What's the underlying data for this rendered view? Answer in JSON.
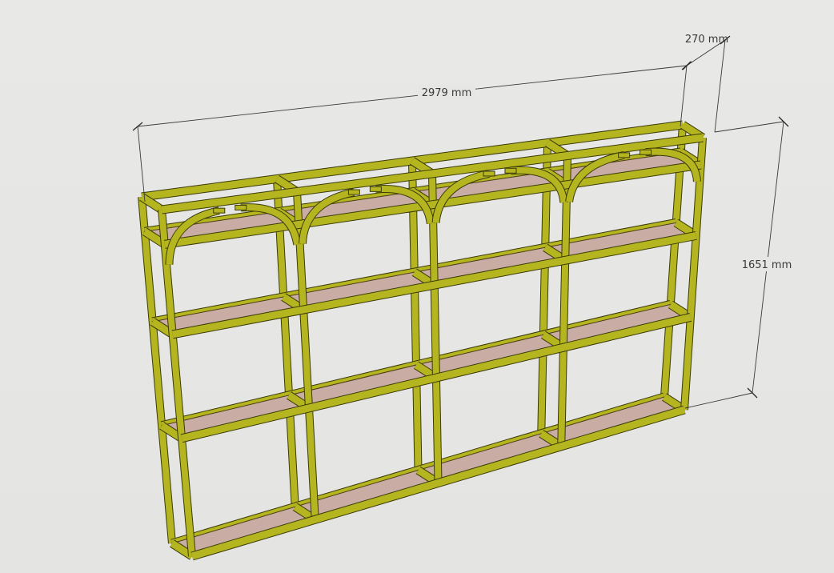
{
  "dimensions": {
    "width_label": "2979 mm",
    "depth_label": "270 mm",
    "height_label": "1651 mm"
  },
  "colors": {
    "background": "#e6e6e4",
    "frame": "#b5b51f",
    "frame_edge": "#3a3a08",
    "shelf": "#c9aca3",
    "dimension_line": "#3a3a3a"
  },
  "model": {
    "bays": 4,
    "shelf_levels": 4,
    "arches_per_bay": 2
  }
}
